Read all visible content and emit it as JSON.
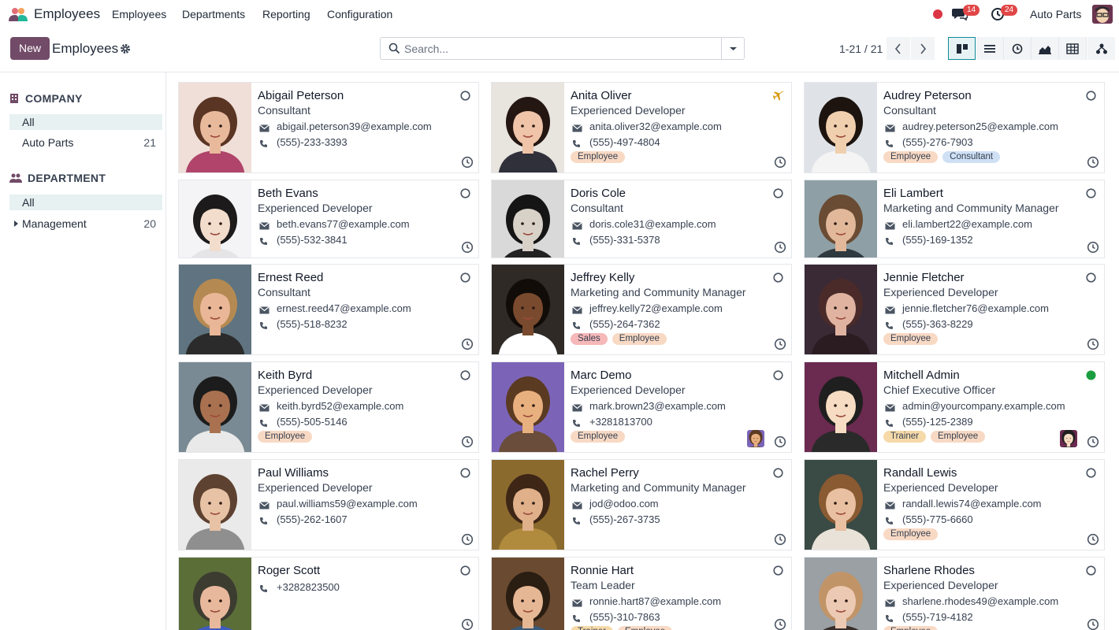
{
  "nav": {
    "app_name": "Employees",
    "menu": [
      "Employees",
      "Departments",
      "Reporting",
      "Configuration"
    ],
    "messages_count": "14",
    "activities_count": "24",
    "company": "Auto Parts"
  },
  "control": {
    "new_label": "New",
    "title": "Employees",
    "search_placeholder": "Search...",
    "pager": "1-21 / 21",
    "views": [
      "kanban-icon",
      "list-icon",
      "activity-icon",
      "graph-icon",
      "pivot-icon",
      "hierarchy-icon"
    ]
  },
  "sidebar": {
    "company_heading": "COMPANY",
    "company_items": [
      {
        "label": "All",
        "count": ""
      },
      {
        "label": "Auto Parts",
        "count": "21"
      }
    ],
    "department_heading": "DEPARTMENT",
    "department_items": [
      {
        "label": "All",
        "count": ""
      },
      {
        "label": "Management",
        "count": "20"
      }
    ]
  },
  "colors": {
    "brand": "#714b67",
    "accent": "#0f8a99",
    "online": "#1a9e3f",
    "badge": "#e14646"
  },
  "employees": [
    {
      "name": "Abigail Peterson",
      "job": "Consultant",
      "email": "abigail.peterson39@example.com",
      "phone": "(555)-233-3393",
      "tags": [],
      "status": "offline"
    },
    {
      "name": "Anita Oliver",
      "job": "Experienced Developer",
      "email": "anita.oliver32@example.com",
      "phone": "(555)-497-4804",
      "tags": [
        "Employee"
      ],
      "status": "away-plane"
    },
    {
      "name": "Audrey Peterson",
      "job": "Consultant",
      "email": "audrey.peterson25@example.com",
      "phone": "(555)-276-7903",
      "tags": [
        "Employee",
        "Consultant"
      ],
      "status": "offline"
    },
    {
      "name": "Beth Evans",
      "job": "Experienced Developer",
      "email": "beth.evans77@example.com",
      "phone": "(555)-532-3841",
      "tags": [],
      "status": "offline"
    },
    {
      "name": "Doris Cole",
      "job": "Consultant",
      "email": "doris.cole31@example.com",
      "phone": "(555)-331-5378",
      "tags": [],
      "status": "offline"
    },
    {
      "name": "Eli Lambert",
      "job": "Marketing and Community Manager",
      "email": "eli.lambert22@example.com",
      "phone": "(555)-169-1352",
      "tags": [],
      "status": "offline"
    },
    {
      "name": "Ernest Reed",
      "job": "Consultant",
      "email": "ernest.reed47@example.com",
      "phone": "(555)-518-8232",
      "tags": [],
      "status": "offline"
    },
    {
      "name": "Jeffrey Kelly",
      "job": "Marketing and Community Manager",
      "email": "jeffrey.kelly72@example.com",
      "phone": "(555)-264-7362",
      "tags": [
        "Sales",
        "Employee"
      ],
      "status": "offline"
    },
    {
      "name": "Jennie Fletcher",
      "job": "Experienced Developer",
      "email": "jennie.fletcher76@example.com",
      "phone": "(555)-363-8229",
      "tags": [
        "Employee"
      ],
      "status": "offline"
    },
    {
      "name": "Keith Byrd",
      "job": "Experienced Developer",
      "email": "keith.byrd52@example.com",
      "phone": "(555)-505-5146",
      "tags": [
        "Employee"
      ],
      "status": "offline"
    },
    {
      "name": "Marc Demo",
      "job": "Experienced Developer",
      "email": "mark.brown23@example.com",
      "phone": "+3281813700",
      "tags": [
        "Employee"
      ],
      "status": "offline"
    },
    {
      "name": "Mitchell Admin",
      "job": "Chief Executive Officer",
      "email": "admin@yourcompany.example.com",
      "phone": "(555)-125-2389",
      "tags": [
        "Trainer",
        "Employee"
      ],
      "status": "online"
    },
    {
      "name": "Paul Williams",
      "job": "Experienced Developer",
      "email": "paul.williams59@example.com",
      "phone": "(555)-262-1607",
      "tags": [],
      "status": "offline"
    },
    {
      "name": "Rachel Perry",
      "job": "Marketing and Community Manager",
      "email": "jod@odoo.com",
      "phone": "(555)-267-3735",
      "tags": [],
      "status": "offline"
    },
    {
      "name": "Randall Lewis",
      "job": "Experienced Developer",
      "email": "randall.lewis74@example.com",
      "phone": "(555)-775-6660",
      "tags": [
        "Employee"
      ],
      "status": "offline"
    },
    {
      "name": "Roger Scott",
      "job": "",
      "email": "",
      "phone": "+3282823500",
      "tags": [],
      "status": "offline"
    },
    {
      "name": "Ronnie Hart",
      "job": "Team Leader",
      "email": "ronnie.hart87@example.com",
      "phone": "(555)-310-7863",
      "tags": [
        "Trainer",
        "Employee"
      ],
      "status": "offline"
    },
    {
      "name": "Sharlene Rhodes",
      "job": "Experienced Developer",
      "email": "sharlene.rhodes49@example.com",
      "phone": "(555)-719-4182",
      "tags": [
        "Employee"
      ],
      "status": "offline"
    }
  ]
}
